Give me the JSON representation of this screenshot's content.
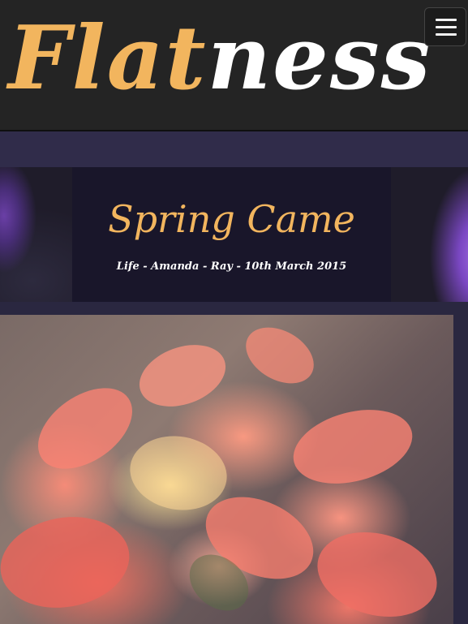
{
  "header": {
    "logo_part1": "Flat",
    "logo_part2": "ness",
    "menu_icon": "hamburger-menu-icon"
  },
  "post": {
    "title": "Spring Came",
    "meta": "Life - Amanda - Ray - 10th March 2015"
  },
  "colors": {
    "accent": "#f2b55e",
    "header_bg": "#242424",
    "page_bg": "#2a2740",
    "title_box_bg": "#19162a"
  }
}
